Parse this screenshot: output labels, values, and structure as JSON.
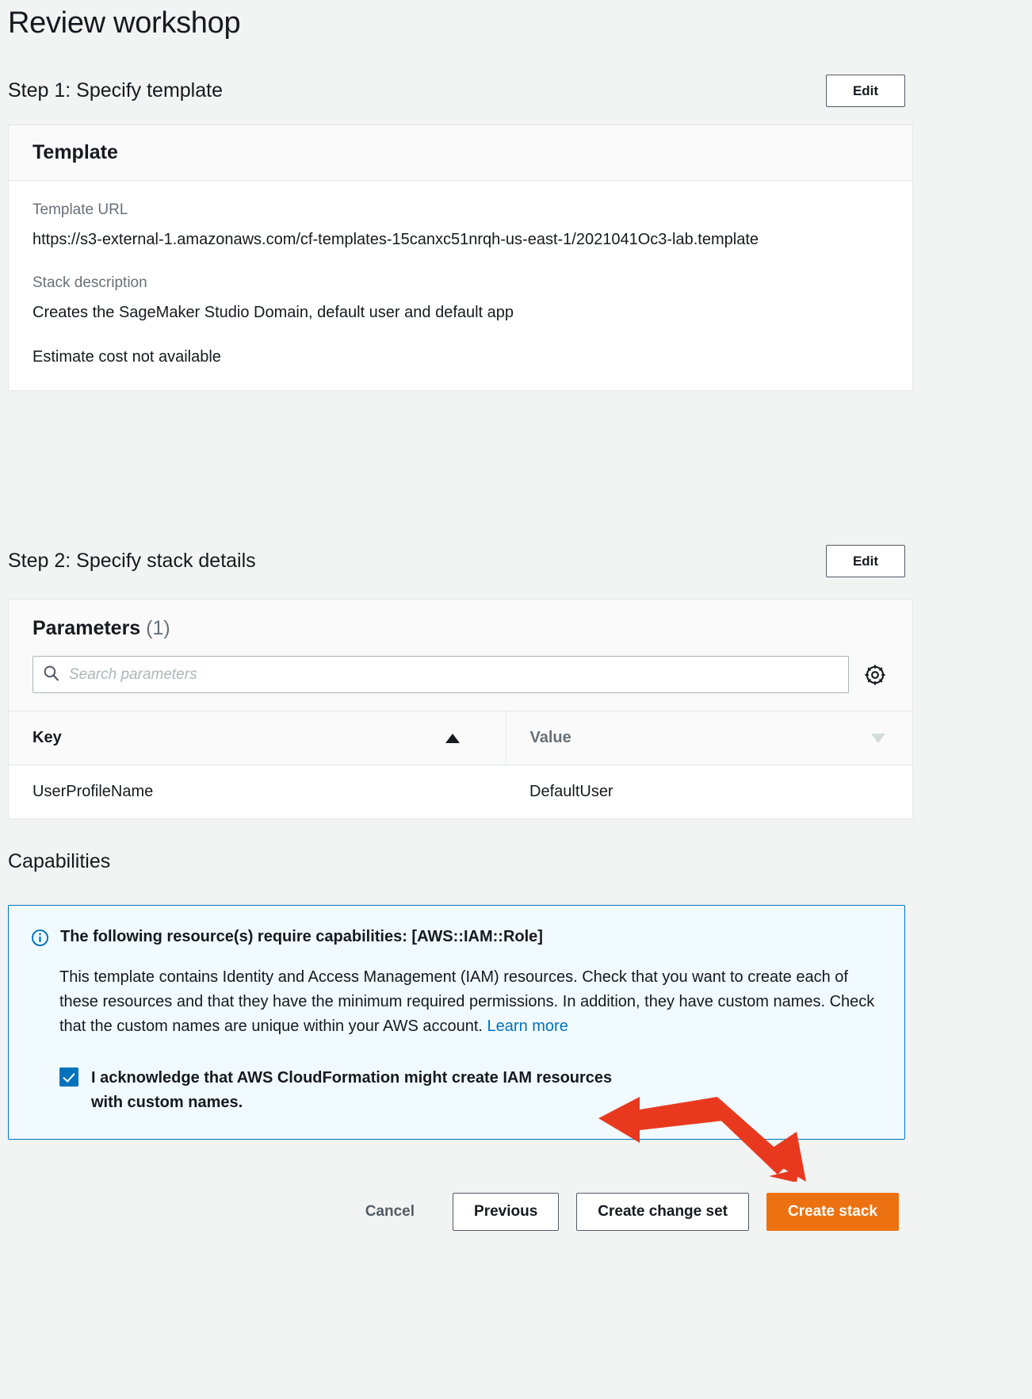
{
  "page": {
    "title": "Review workshop"
  },
  "step1": {
    "title": "Step 1: Specify template",
    "edit_label": "Edit",
    "card_title": "Template",
    "template_url_label": "Template URL",
    "template_url_value": "https://s3-external-1.amazonaws.com/cf-templates-15canxc51nrqh-us-east-1/2021041Oc3-lab.template",
    "stack_description_label": "Stack description",
    "stack_description_value": "Creates the SageMaker Studio Domain, default user and default app",
    "cost_note": "Estimate cost not available"
  },
  "step2": {
    "title": "Step 2: Specify stack details",
    "edit_label": "Edit",
    "parameters_title": "Parameters",
    "parameters_count": "(1)",
    "search_placeholder": "Search parameters",
    "search_value": "",
    "search_icon": "search-icon",
    "settings_icon": "gear-icon",
    "table": {
      "columns": [
        "Key",
        "Value"
      ],
      "sort_asc_icon": "sort-ascending-icon",
      "sort_desc_icon": "sort-descending-icon",
      "rows": [
        {
          "key": "UserProfileName",
          "value": "DefaultUser"
        }
      ]
    }
  },
  "capabilities": {
    "title": "Capabilities",
    "alert_icon": "info-icon",
    "alert_heading": "The following resource(s) require capabilities: [AWS::IAM::Role]",
    "alert_body": "This template contains Identity and Access Management (IAM) resources. Check that you want to create each of these resources and that they have the minimum required permissions. In addition, they have custom names. Check that the custom names are unique within your AWS account.",
    "learn_more_label": "Learn more",
    "acknowledge_checked": true,
    "acknowledge_label": "I acknowledge that AWS CloudFormation might create IAM resources with custom names."
  },
  "footer": {
    "cancel_label": "Cancel",
    "previous_label": "Previous",
    "create_change_set_label": "Create change set",
    "create_stack_label": "Create stack"
  },
  "colors": {
    "accent_orange": "#ec7211",
    "link_blue": "#0073bb",
    "alert_bg": "#f1faff",
    "page_bg": "#f2f3f3",
    "annotation_red": "#e8391f"
  }
}
